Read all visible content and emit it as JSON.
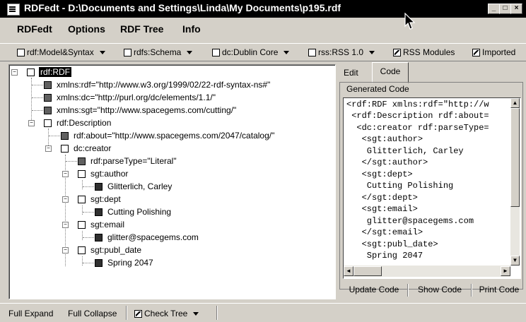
{
  "window": {
    "title": "RDFedt - D:\\Documents and Settings\\Linda\\My Documents\\p195.rdf",
    "minimize": "_",
    "maximize": "□",
    "close": "×"
  },
  "menubar": {
    "items": [
      "RDFedt",
      "Options",
      "RDF Tree",
      "Info"
    ]
  },
  "toolbar": {
    "items": [
      {
        "label": "rdf:Model&Syntax",
        "checked": false,
        "dropdown": true
      },
      {
        "label": "rdfs:Schema",
        "checked": false,
        "dropdown": true
      },
      {
        "label": "dc:Dublin Core",
        "checked": false,
        "dropdown": true
      },
      {
        "label": "rss:RSS 1.0",
        "checked": false,
        "dropdown": true
      },
      {
        "label": "RSS Modules",
        "checked": true,
        "dropdown": false
      },
      {
        "label": "Imported",
        "checked": true,
        "dropdown": false
      }
    ]
  },
  "tree": {
    "nodes": [
      {
        "label": "rdf:RDF"
      },
      {
        "label": "xmlns:rdf=\"http://www.w3.org/1999/02/22-rdf-syntax-ns#\""
      },
      {
        "label": "xmlns:dc=\"http://purl.org/dc/elements/1.1/\""
      },
      {
        "label": "xmlns:sgt=\"http://www.spacegems.com/cutting/\""
      },
      {
        "label": "rdf:Description"
      },
      {
        "label": "rdf:about=\"http://www.spacegems.com/2047/catalog/\""
      },
      {
        "label": "dc:creator"
      },
      {
        "label": "rdf:parseType=\"Literal\""
      },
      {
        "label": "sgt:author"
      },
      {
        "label": "Glitterlich, Carley"
      },
      {
        "label": "sgt:dept"
      },
      {
        "label": "Cutting Polishing"
      },
      {
        "label": "sgt:email"
      },
      {
        "label": "glitter@spacegems.com"
      },
      {
        "label": "sgt:publ_date"
      },
      {
        "label": "Spring 2047"
      }
    ]
  },
  "tabs": [
    "Edit",
    "Code"
  ],
  "code": {
    "group_label": "Generated Code",
    "lines": [
      "<rdf:RDF xmlns:rdf=\"http://w",
      " <rdf:Description rdf:about=",
      "  <dc:creator rdf:parseType=",
      "   <sgt:author>",
      "    Glitterlich, Carley",
      "   </sgt:author>",
      "   <sgt:dept>",
      "    Cutting Polishing",
      "   </sgt:dept>",
      "   <sgt:email>",
      "    glitter@spacegems.com",
      "   </sgt:email>",
      "   <sgt:publ_date>",
      "    Spring 2047"
    ]
  },
  "buttons": {
    "update": "Update Code",
    "show": "Show Code",
    "print": "Print Code"
  },
  "statusbar": {
    "full_expand": "Full Expand",
    "full_collapse": "Full Collapse",
    "check_tree": "Check Tree"
  }
}
